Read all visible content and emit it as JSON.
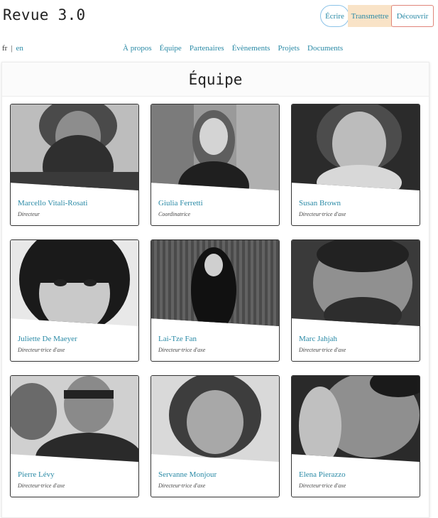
{
  "header": {
    "brand": "Revue 3.0",
    "buttons": {
      "ecrire": "Écrire",
      "transmettre": "Transmettre",
      "decouvrir": "Découvrir"
    }
  },
  "lang": {
    "current": "fr",
    "separator": "|",
    "other": "en"
  },
  "nav": [
    "À propos",
    "Équipe",
    "Partenaires",
    "Évènements",
    "Projets",
    "Documents"
  ],
  "page": {
    "title": "Équipe"
  },
  "members": [
    {
      "name": "Marcello Vitali-Rosati",
      "role": "Directeur"
    },
    {
      "name": "Giulia Ferretti",
      "role": "Coordinatrice"
    },
    {
      "name": "Susan Brown",
      "role": "Directeur·trice d'axe"
    },
    {
      "name": "Juliette De Maeyer",
      "role": "Directeur·trice d'axe"
    },
    {
      "name": "Lai-Tze Fan",
      "role": "Directeur·trice d'axe"
    },
    {
      "name": "Marc Jahjah",
      "role": "Directeur·trice d'axe"
    },
    {
      "name": "Pierre Lévy",
      "role": "Directeur·trice d'axe"
    },
    {
      "name": "Servanne Monjour",
      "role": "Directeur·trice d'axe"
    },
    {
      "name": "Elena Pierazzo",
      "role": "Directeur·trice d'axe"
    }
  ]
}
